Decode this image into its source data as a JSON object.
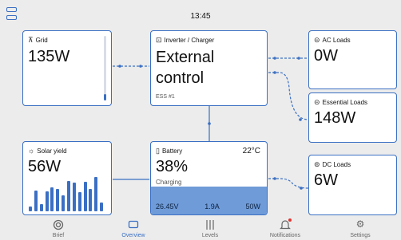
{
  "status_bar": {
    "time": "13:45",
    "menu_icon": "menu-icon"
  },
  "cards": {
    "grid": {
      "title": "Grid",
      "value": "135",
      "unit": "W",
      "icon": "grid-tower-icon",
      "level": 0.1
    },
    "inverter": {
      "title": "Inverter / Charger",
      "value": "External control",
      "mode": "ESS #1",
      "icon": "inverter-icon"
    },
    "ac_loads": {
      "title": "AC Loads",
      "value": "0",
      "unit": "W",
      "icon": "ac-plug-icon"
    },
    "essential_loads": {
      "title": "Essential Loads",
      "value": "148",
      "unit": "W",
      "icon": "ac-plug-icon"
    },
    "dc_loads": {
      "title": "DC Loads",
      "value": "6",
      "unit": "W",
      "icon": "dc-plug-icon"
    },
    "solar": {
      "title": "Solar yield",
      "value": "56",
      "unit": "W",
      "icon": "sun-icon",
      "history": [
        0.12,
        0.55,
        0.18,
        0.52,
        0.62,
        0.58,
        0.42,
        0.8,
        0.75,
        0.5,
        0.78,
        0.58,
        0.9,
        0.22
      ]
    },
    "battery": {
      "title": "Battery",
      "soc": "38",
      "unit": "%",
      "temperature": "22°C",
      "state": "Charging",
      "voltage": "26.45V",
      "current": "1.9A",
      "power": "50W",
      "icon": "battery-icon",
      "level": 0.38
    }
  },
  "nav": [
    {
      "label": "Brief",
      "icon": "brief-gauge-icon",
      "active": false
    },
    {
      "label": "Overview",
      "icon": "overview-icon",
      "active": true
    },
    {
      "label": "Levels",
      "icon": "levels-icon",
      "active": false
    },
    {
      "label": "Notifications",
      "icon": "bell-icon",
      "active": false,
      "has_alert": true
    },
    {
      "label": "Settings",
      "icon": "gear-icon",
      "active": false
    }
  ],
  "colors": {
    "accent": "#3a6fc3",
    "battery_fill": "#6f9bd8",
    "background": "#ececec",
    "alert": "#e0342f"
  }
}
